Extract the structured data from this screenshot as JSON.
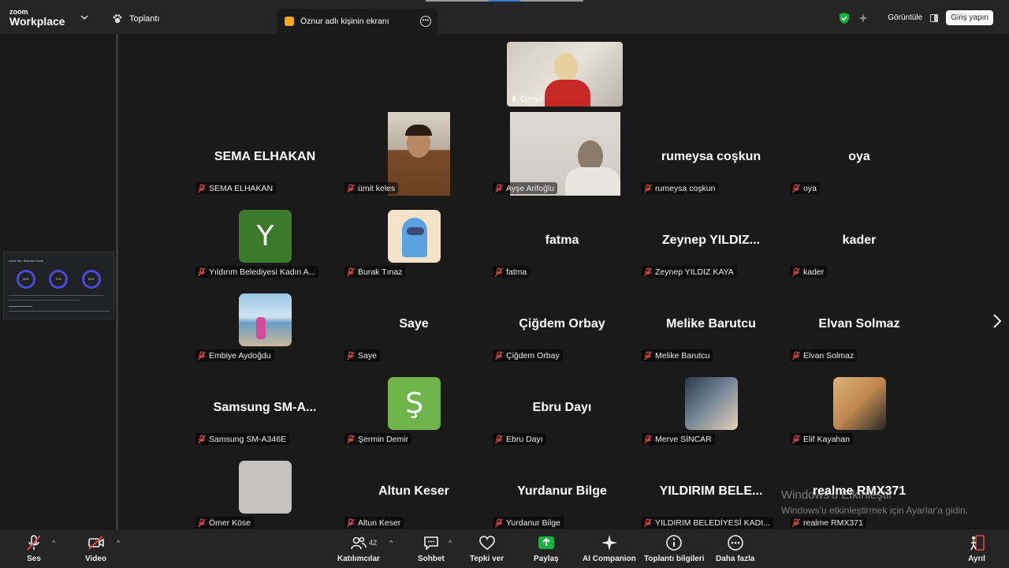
{
  "app": {
    "brand_small": "zoom",
    "brand": "Workplace",
    "meeting_label": "Toplantı"
  },
  "share_tab": {
    "label": "Öznur adlı kişinin ekranı"
  },
  "top_right": {
    "view_label": "Görüntüle",
    "login_label": "Giriş yapın"
  },
  "thumbnail": {
    "title": "Umut Var, Sizecek Panik",
    "rings": [
      "60%",
      "70%",
      "80%"
    ]
  },
  "active_speaker": {
    "name": "Öznur"
  },
  "participants": [
    {
      "big": "SEMA ELHAKAN",
      "label": "SEMA ELHAKAN"
    },
    {
      "big": "",
      "label": "ümit keles",
      "video": true
    },
    {
      "big": "",
      "label": "Ayşe Arifoğlu",
      "video": true
    },
    {
      "big": "rumeysa coşkun",
      "label": "rumeysa coşkun"
    },
    {
      "big": "oya",
      "label": "oya"
    },
    {
      "big": "",
      "label": "Yıldırım Belediyesi Kadın A...",
      "avatar_letter": "Y"
    },
    {
      "big": "",
      "label": "Burak Tınaz",
      "avatar": "amongus"
    },
    {
      "big": "fatma",
      "label": "fatma"
    },
    {
      "big": "Zeynep YILDIZ...",
      "label": "Zeynep YILDIZ KAYA"
    },
    {
      "big": "kader",
      "label": "kader"
    },
    {
      "big": "",
      "label": "Embiye Aydoğdu",
      "avatar": "beach"
    },
    {
      "big": "Saye",
      "label": "Saye"
    },
    {
      "big": "Çiğdem Orbay",
      "label": "Çiğdem Orbay"
    },
    {
      "big": "Melike Barutcu",
      "label": "Melike Barutcu"
    },
    {
      "big": "Elvan Solmaz",
      "label": "Elvan Solmaz"
    },
    {
      "big": "Samsung SM-A...",
      "label": "Samsung SM-A346E"
    },
    {
      "big": "",
      "label": "Şermin Demir",
      "avatar_letter": "Ş"
    },
    {
      "big": "Ebru Dayı",
      "label": "Ebru Dayı"
    },
    {
      "big": "",
      "label": "Merve SİNCAR",
      "avatar": "photo"
    },
    {
      "big": "",
      "label": "Elif Kayahan",
      "avatar": "photo2"
    },
    {
      "big": "",
      "label": "Ömer Köse",
      "avatar": "grey"
    },
    {
      "big": "Altun Keser",
      "label": "Altun Keser"
    },
    {
      "big": "Yurdanur Bilge",
      "label": "Yurdanur Bilge"
    },
    {
      "big": "YILDIRIM BELE...",
      "label": "YILDIRIM BELEDİYESİ KADI..."
    },
    {
      "big": "realme RMX371",
      "label": "realme RMX371"
    }
  ],
  "watermark": {
    "line1": "Windows'u Etkinleştir",
    "line2": "Windows'u etkinleştirmek için Ayarlar'a gidin."
  },
  "toolbar": {
    "audio": "Ses",
    "video": "Video",
    "participants": "Katılımcılar",
    "participant_count": "42",
    "chat": "Sohbet",
    "react": "Tepki ver",
    "share": "Paylaş",
    "ai": "AI Companion",
    "info": "Toplantı bilgileri",
    "more": "Daha fazla",
    "leave": "Ayrıl"
  },
  "colors": {
    "bg": "#1a1a1a",
    "bar": "#242424",
    "muted_red": "#e04a4a",
    "share_green": "#18b33f",
    "avatar_green": "#3c7a2b"
  }
}
